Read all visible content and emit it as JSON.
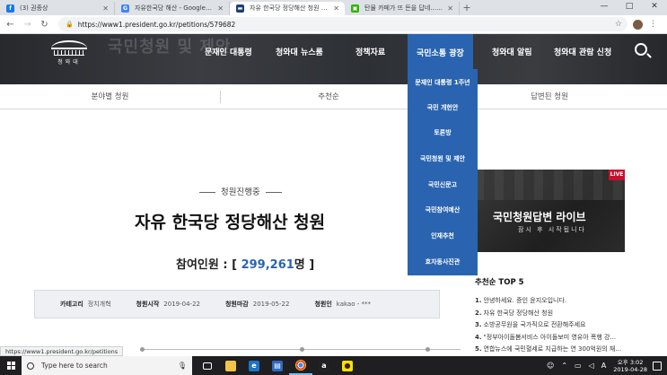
{
  "browser": {
    "tabs": [
      {
        "title": "(3) 권종상",
        "favicon_color": "#1877f2",
        "favicon_glyph": "f"
      },
      {
        "title": "자유한국당 해산 - Google Search",
        "favicon_color": "#4285f4",
        "favicon_glyph": "G"
      },
      {
        "title": "자유 한국당 정당해산 청원 > 대",
        "favicon_color": "#1c3f7a",
        "favicon_glyph": "▬"
      },
      {
        "title": "탄물 카페가 뜨 돈을 답네... 네이",
        "favicon_color": "#2db400",
        "favicon_glyph": "▣"
      }
    ],
    "new_tab": "+",
    "window_controls": [
      "—",
      "□",
      "✕"
    ],
    "url": "https://www1.president.go.kr/petitions/579682",
    "status_url": "https://www1.president.go.kr/petitions"
  },
  "site": {
    "bg_title": "국민청원 및 제안",
    "logo_name": "청와대",
    "gnb": [
      "문재인 대통령",
      "청와대 뉴스룸",
      "정책자료",
      "국민소통 광장",
      "청와대 알림",
      "청와대 관람 신청"
    ],
    "gnb_active_index": 3,
    "accent_color": "#2a64b0"
  },
  "subtabs": [
    "분야별 청원",
    "추천순",
    "답변된 청원"
  ],
  "dropdown": [
    "문재인 대통령 1주년",
    "국민 개헌안",
    "토론방",
    "국민청원 및 제안",
    "국민신문고",
    "국민참여예산",
    "인재추천",
    "효자동사진관"
  ],
  "petition": {
    "status": "청원진행중",
    "title": "자유 한국당 정당해산 청원",
    "count_label": "참여인원 : [",
    "count_value": "299,261",
    "count_suffix": "명 ]",
    "info": [
      {
        "k": "카테고리",
        "v": "정치개혁"
      },
      {
        "k": "청원시작",
        "v": "2019-04-22"
      },
      {
        "k": "청원마감",
        "v": "2019-05-22"
      },
      {
        "k": "청원인",
        "v": "kakao - ***"
      }
    ]
  },
  "banner": {
    "live_badge": "LIVE",
    "title": "국민청원답변 라이브",
    "subtitle": "잠시 후 시작됩니다"
  },
  "top5": {
    "title": "추천순 TOP 5",
    "items": [
      {
        "n": "1.",
        "t": "안녕하세요. 증인 윤지오입니다."
      },
      {
        "n": "2.",
        "t": "자유 한국당 정당해산 청원"
      },
      {
        "n": "3.",
        "t": "소방공무원을 국가직으로 전환해주세요"
      },
      {
        "n": "4.",
        "t": "\"정부아이돌봄서비스 아이돌보미 영유아 폭행 강..."
      },
      {
        "n": "5.",
        "t": "연합뉴스에 국민혈세로 지급하는 연 300억원의 재..."
      }
    ]
  },
  "taskbar": {
    "search_placeholder": "Type here to search",
    "time": "오후 3:02",
    "date": "2019-04-28"
  }
}
